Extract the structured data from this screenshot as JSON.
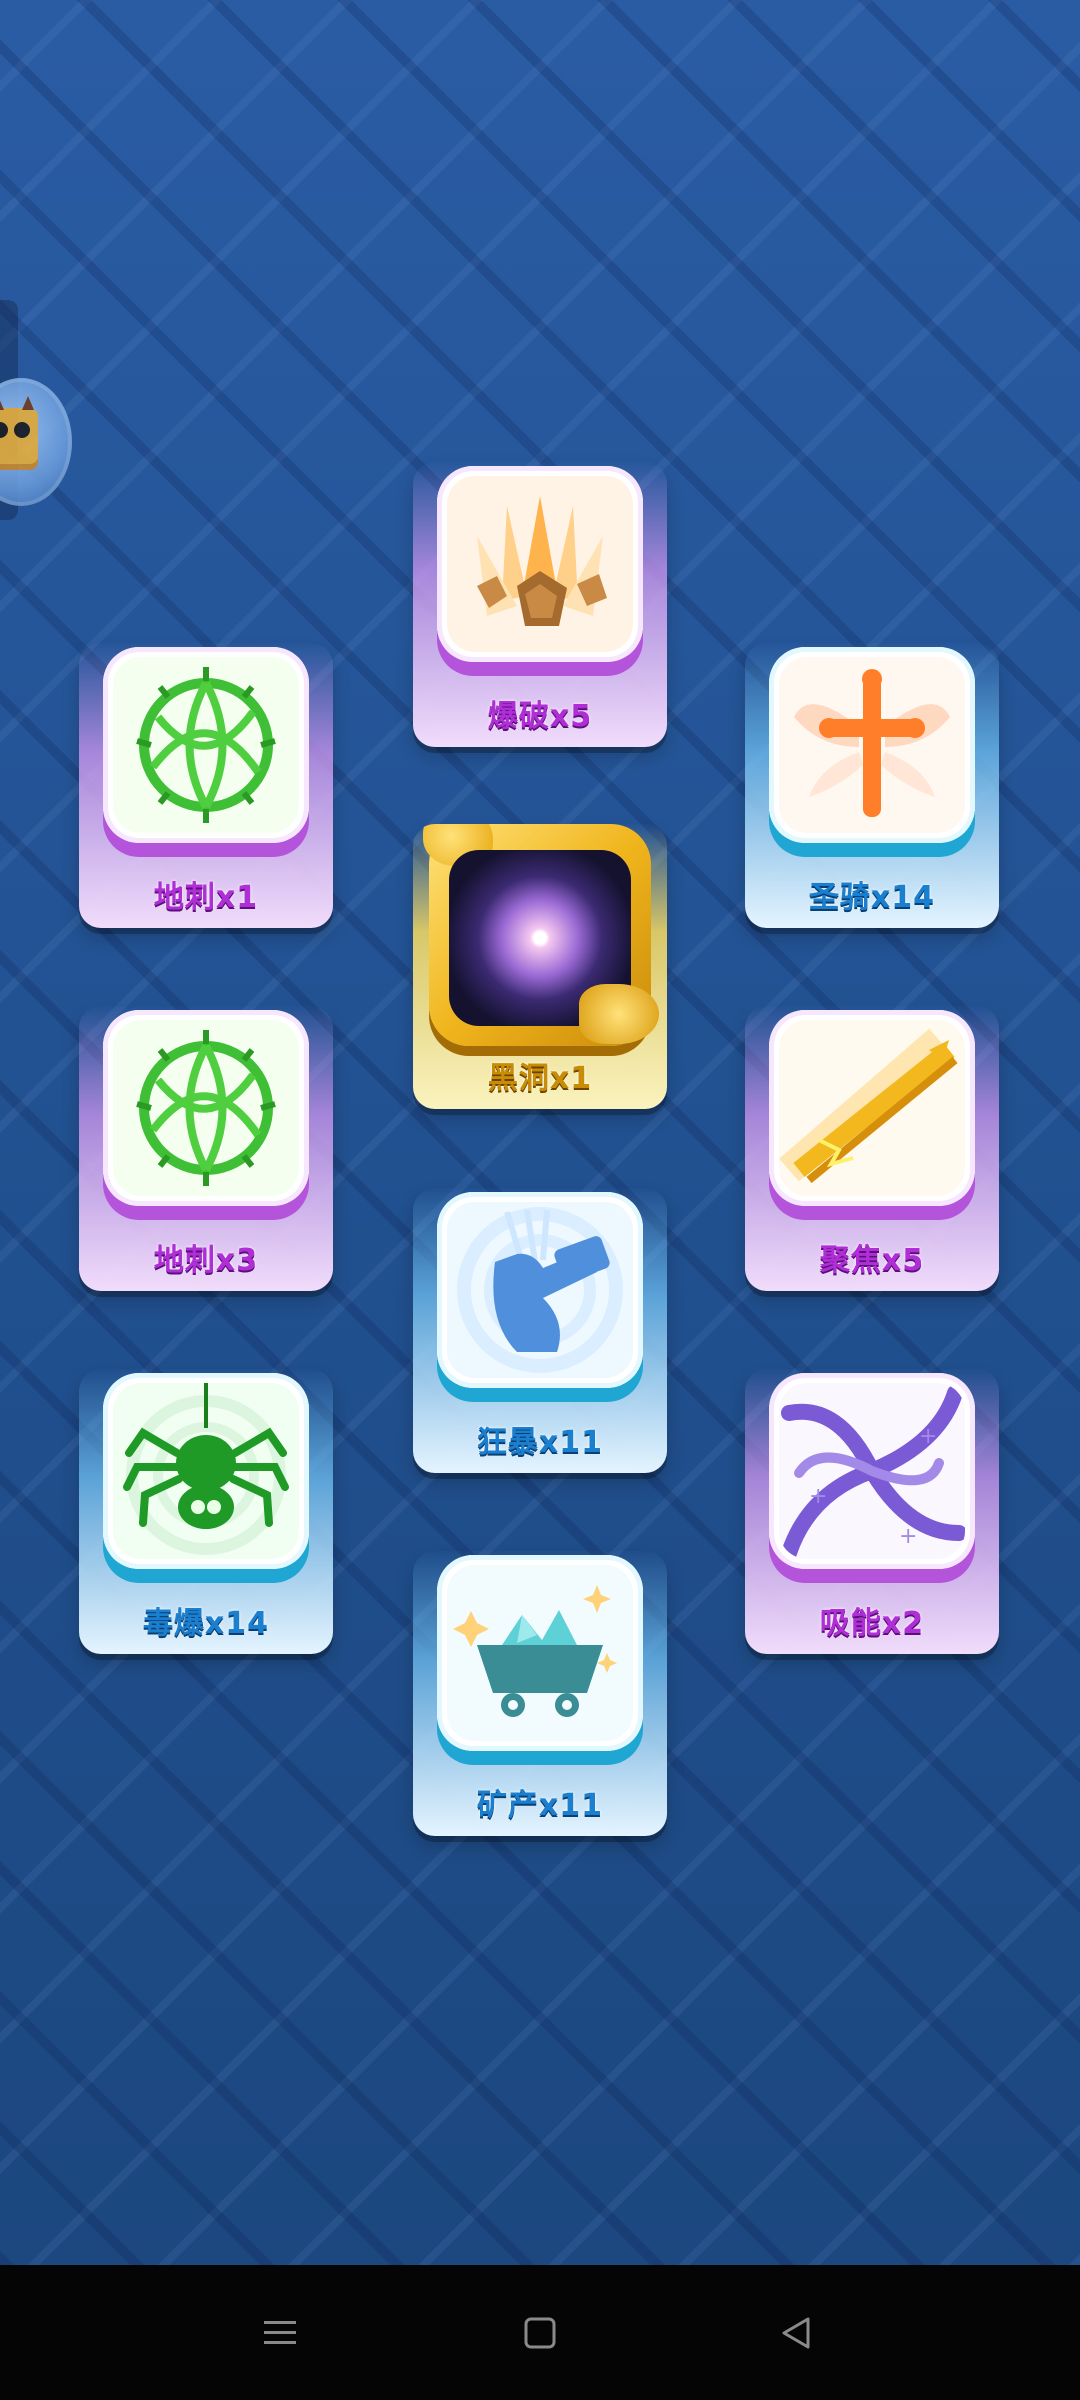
{
  "skills": [
    {
      "id": "explode",
      "label": "爆破x5",
      "theme": "purple",
      "icon": "explosion-icon"
    },
    {
      "id": "spike1",
      "label": "地刺x1",
      "theme": "purple",
      "icon": "thorn-bush-icon"
    },
    {
      "id": "paladin",
      "label": "圣骑x14",
      "theme": "blue",
      "icon": "winged-cross-icon"
    },
    {
      "id": "blackhole",
      "label": "黑洞x1",
      "theme": "gold",
      "icon": "black-hole-icon"
    },
    {
      "id": "spike3",
      "label": "地刺x3",
      "theme": "purple",
      "icon": "thorn-bush-icon"
    },
    {
      "id": "focus",
      "label": "聚焦x5",
      "theme": "purple",
      "icon": "focus-beam-icon"
    },
    {
      "id": "rage",
      "label": "狂暴x11",
      "theme": "blue",
      "icon": "hammer-icon"
    },
    {
      "id": "poison",
      "label": "毒爆x14",
      "theme": "blue",
      "icon": "spider-icon"
    },
    {
      "id": "absorb",
      "label": "吸能x2",
      "theme": "purple",
      "icon": "swirl-icon"
    },
    {
      "id": "mine",
      "label": "矿产x11",
      "theme": "blue",
      "icon": "mine-cart-icon"
    }
  ],
  "colors": {
    "purple_accent": "#b454db",
    "blue_accent": "#1fa6d2",
    "gold_accent": "#f0b51d",
    "background": "#1f4d8f"
  },
  "navbar": {
    "menu_icon": "menu-icon",
    "home_icon": "home-icon",
    "back_icon": "back-icon"
  }
}
